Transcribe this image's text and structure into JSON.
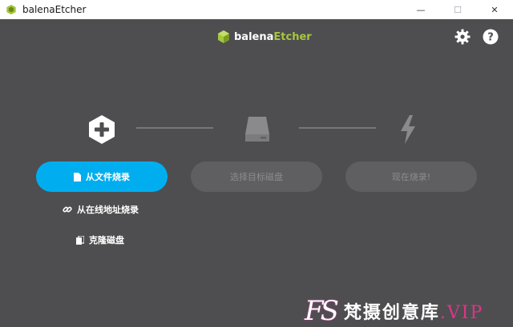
{
  "window": {
    "title": "balenaEtcher",
    "minimize_glyph": "—",
    "maximize_glyph": "☐",
    "close_glyph": "✕"
  },
  "header": {
    "logo_part1": "balena",
    "logo_part2": "Etcher",
    "settings_icon": "gear-icon",
    "help_icon": "help-icon"
  },
  "steps": {
    "flash_from_file": "从文件烧录",
    "select_target": "选择目标磁盘",
    "flash_now": "现在烧录!",
    "flash_from_url": "从在线地址烧录",
    "clone_drive": "克隆磁盘"
  },
  "watermark": {
    "logo": "FS",
    "text": "梵摄创意库",
    "suffix": ".VIP"
  },
  "colors": {
    "accent": "#00aeef",
    "brand_green": "#a6c63f",
    "background": "#4e4e50"
  }
}
